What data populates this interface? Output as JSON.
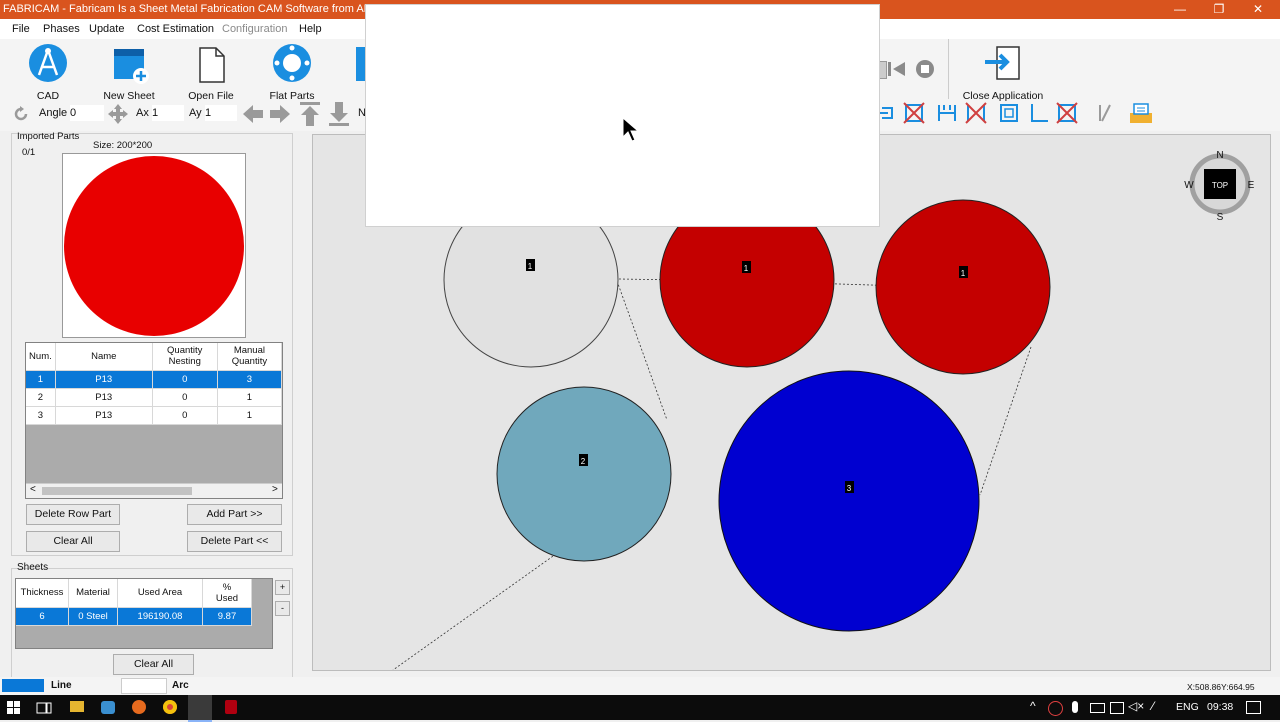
{
  "window": {
    "title": "FABRICAM - Fabricam Is a Sheet Metal Fabrication CAM Software from AM.CO.ZA",
    "controls": {
      "minimize": "—",
      "maximize": "❐",
      "close": "✕"
    }
  },
  "menu": [
    "File",
    "Phases",
    "Update",
    "Cost Estimation",
    "Configuration",
    "Help"
  ],
  "toolbar": {
    "cad": "CAD",
    "new_sheet": "New Sheet",
    "open_file": "Open File",
    "flat_parts": "Flat Parts",
    "close_app": "Close Application",
    "angle_label": "Angle",
    "angle_value": "0",
    "ax_label": "Ax",
    "ax_value": "1",
    "ay_label": "Ay",
    "ay_value": "1",
    "n_label": "N"
  },
  "imported_parts": {
    "label": "Imported Parts",
    "count": "0/1",
    "size": "Size: 200*200",
    "preview_color": "#e80000"
  },
  "parts_table": {
    "headers": [
      "Num.",
      "Name",
      "Quantity Nesting",
      "Manual Quantity"
    ],
    "header_lines": [
      [
        "Num."
      ],
      [
        "Name"
      ],
      [
        "Quantity",
        "Nesting"
      ],
      [
        "Manual",
        "Quantity"
      ]
    ],
    "rows": [
      [
        "1",
        "P13",
        "0",
        "3"
      ],
      [
        "2",
        "P13",
        "0",
        "1"
      ],
      [
        "3",
        "P13",
        "0",
        "1"
      ]
    ],
    "scroll_left": "<",
    "scroll_right": ">"
  },
  "parts_buttons": {
    "delete_row": "Delete Row Part",
    "add_part": "Add Part >>",
    "clear_all": "Clear All",
    "delete_part": "Delete Part <<"
  },
  "sheets": {
    "label": "Sheets",
    "headers": [
      "Thickness",
      "Material",
      "Used Area",
      "% Used"
    ],
    "header_lines": [
      [
        "Thickness"
      ],
      [
        "Material"
      ],
      [
        "Used Area"
      ],
      [
        "%",
        "Used"
      ]
    ],
    "row": [
      "6",
      "0  Steel",
      "196190.08",
      "9.87"
    ],
    "plus": "+",
    "minus": "-",
    "clear_all": "Clear All"
  },
  "canvas": {
    "compass": {
      "n": "N",
      "s": "S",
      "e": "E",
      "w": "W",
      "center": "TOP"
    },
    "circles": [
      {
        "label": "1",
        "color": "#e1e1e1"
      },
      {
        "label": "1",
        "color": "#c40000"
      },
      {
        "label": "1",
        "color": "#c40000"
      },
      {
        "label": "2",
        "color": "#70a8bc"
      },
      {
        "label": "3",
        "color": "#0000d0"
      }
    ]
  },
  "status": {
    "line_label": "Line",
    "arc_label": "Arc",
    "line_color": "#0a78d7",
    "coords": "X:508.86Y:664.95"
  },
  "taskbar": {
    "language": "ENG",
    "time": "09:38"
  }
}
